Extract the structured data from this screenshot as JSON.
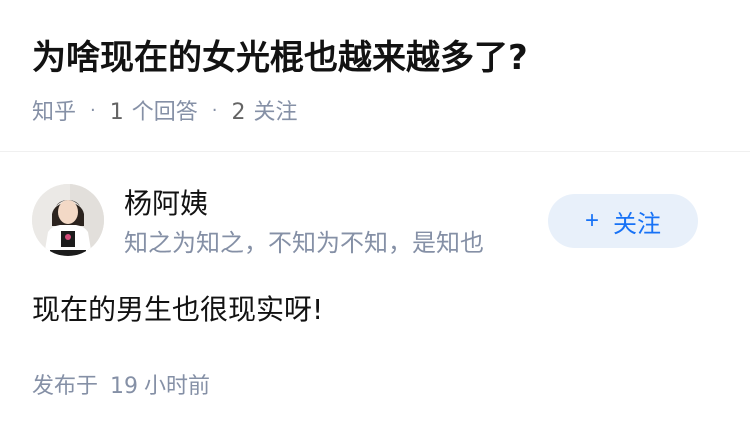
{
  "question": {
    "title": "为啥现在的女光棍也越来越多了?",
    "source": "知乎",
    "answer_count": "1",
    "answer_label": "个回答",
    "follow_count": "2",
    "follow_label": "关注"
  },
  "answer": {
    "author": {
      "name": "杨阿姨",
      "bio": "知之为知之，不知为不知，是知也",
      "follow_button": {
        "icon": "+",
        "label": "关注"
      }
    },
    "content": "现在的男生也很现实呀!",
    "published_prefix": "发布于",
    "published_num": "19",
    "published_unit": "小时前"
  },
  "colors": {
    "title": "#121212",
    "meta": "#8590a6",
    "accent": "#1772f6",
    "follow_bg": "#e8f0fa"
  }
}
